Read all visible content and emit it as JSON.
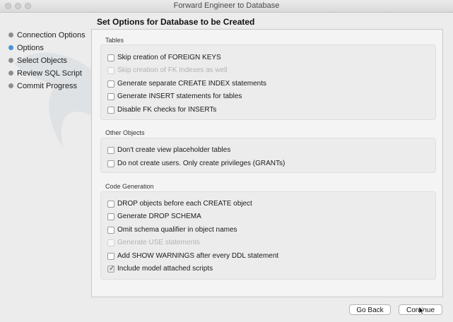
{
  "window": {
    "title": "Forward Engineer to Database"
  },
  "sidebar": {
    "items": [
      {
        "label": "Connection Options",
        "active": false
      },
      {
        "label": "Options",
        "active": true
      },
      {
        "label": "Select Objects",
        "active": false
      },
      {
        "label": "Review SQL Script",
        "active": false
      },
      {
        "label": "Commit Progress",
        "active": false
      }
    ]
  },
  "main": {
    "heading": "Set Options for Database to be Created",
    "groups": [
      {
        "title": "Tables",
        "options": [
          {
            "label": "Skip creation of FOREIGN KEYS",
            "checked": false,
            "enabled": true
          },
          {
            "label": "Skip creation of FK Indexes as well",
            "checked": false,
            "enabled": false
          },
          {
            "label": "Generate separate CREATE INDEX statements",
            "checked": false,
            "enabled": true
          },
          {
            "label": "Generate INSERT statements for tables",
            "checked": false,
            "enabled": true
          },
          {
            "label": "Disable FK checks for INSERTs",
            "checked": false,
            "enabled": true
          }
        ]
      },
      {
        "title": "Other Objects",
        "options": [
          {
            "label": "Don't create view placeholder tables",
            "checked": false,
            "enabled": true
          },
          {
            "label": "Do not create users. Only create privileges (GRANTs)",
            "checked": false,
            "enabled": true
          }
        ]
      },
      {
        "title": "Code Generation",
        "options": [
          {
            "label": "DROP objects before each CREATE object",
            "checked": false,
            "enabled": true
          },
          {
            "label": "Generate DROP SCHEMA",
            "checked": false,
            "enabled": true
          },
          {
            "label": "Omit schema qualifier in object names",
            "checked": false,
            "enabled": true
          },
          {
            "label": "Generate USE statements",
            "checked": false,
            "enabled": false
          },
          {
            "label": "Add SHOW WARNINGS after every DDL statement",
            "checked": false,
            "enabled": true
          },
          {
            "label": "Include model attached scripts",
            "checked": true,
            "enabled": true
          }
        ]
      }
    ]
  },
  "footer": {
    "back_label": "Go Back",
    "continue_label": "Continue"
  }
}
